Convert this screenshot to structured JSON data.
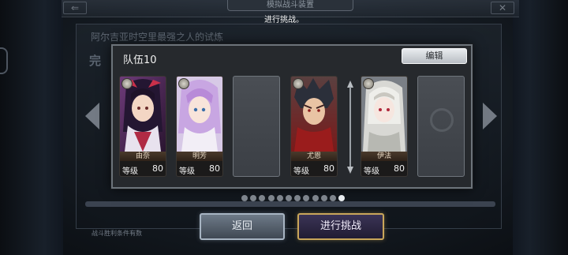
{
  "background": {
    "header_title": "模拟战斗装置",
    "subtitle": "阿尔吉亚时空里最强之人的试炼",
    "big_label": "完",
    "footer_text": "战斗胜利条件有数"
  },
  "toast": "进行挑战。",
  "dialog": {
    "title": "队伍10",
    "edit_label": "编辑"
  },
  "members": [
    {
      "name": "由奈",
      "level_label": "等级",
      "level": "80"
    },
    {
      "name": "明芳",
      "level_label": "等级",
      "level": "80"
    },
    {
      "name": "尤恩",
      "level_label": "等级",
      "level": "80"
    },
    {
      "name": "伊法",
      "level_label": "等级",
      "level": "80"
    }
  ],
  "pager": {
    "count": 12,
    "active_index": 11
  },
  "buttons": {
    "back_label": "返回",
    "challenge_label": "进行挑战"
  },
  "colors": {
    "challenge_border": "#c9a65a",
    "back_border": "#a7b4c2",
    "dialog_bg": "#26292d"
  }
}
